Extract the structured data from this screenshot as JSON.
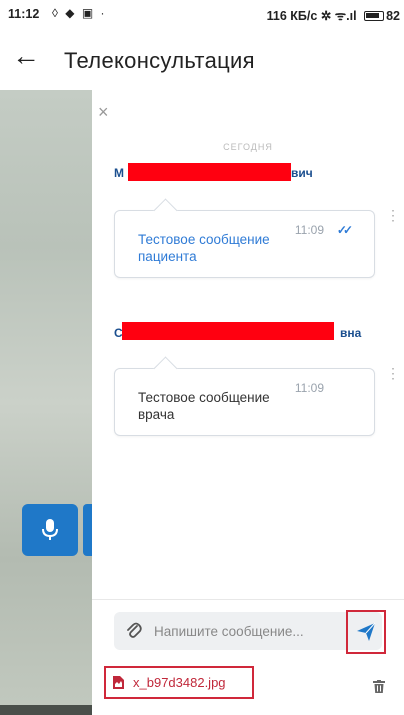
{
  "status_bar": {
    "time": "11:12",
    "left_icons": "◊ ◆ ▣ ·",
    "net_speed": "116 КБ/с",
    "signal": "✲ ᯤ.ıl",
    "battery": "82"
  },
  "app_bar": {
    "back_icon": "←",
    "title": "Телеконсультация"
  },
  "chat": {
    "close_icon": "×",
    "date_label": "СЕГОДНЯ",
    "messages": [
      {
        "sender_first": "М",
        "sender_last": "вич",
        "text": "Тестовое сообщение пациента",
        "time": "11:09",
        "status": "✓✓"
      },
      {
        "sender_first": "С",
        "sender_last": "вна",
        "text": "Тестовое сообщение врача",
        "time": "11:09",
        "status": ""
      }
    ],
    "kebab_icon": "⋮",
    "input": {
      "placeholder": "Напишите сообщение..."
    },
    "attachment": {
      "filename": "x_b97d3482.jpg"
    }
  },
  "icons": {
    "mic": "microphone-icon",
    "attach": "paperclip-icon",
    "send": "send-icon",
    "file": "file-icon",
    "trash": "trash-icon"
  },
  "colors": {
    "accent": "#1f78c8",
    "sender_name": "#1b4f8f",
    "patient_text": "#2f7bd6",
    "highlight": "#d0283a",
    "redaction": "#ff0010"
  }
}
